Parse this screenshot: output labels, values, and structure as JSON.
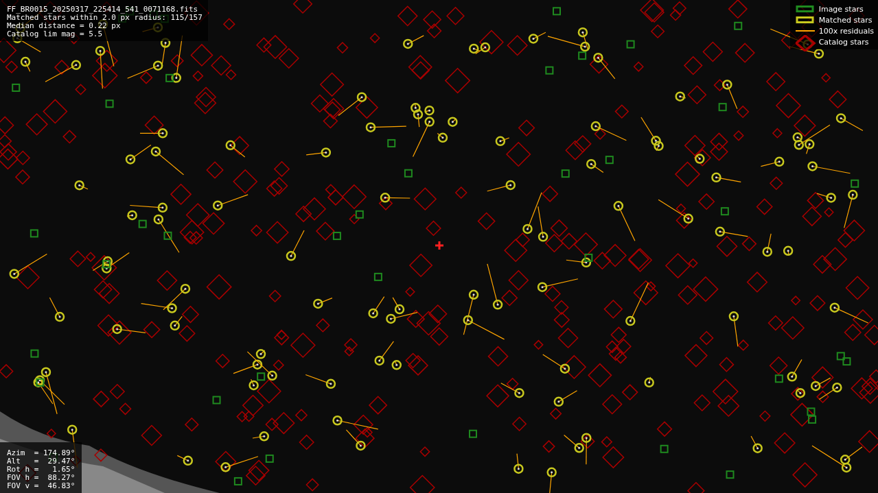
{
  "info_panel": {
    "lines": [
      "FF_BR0015_20250317_225414_541_0071168.fits",
      "Matched stars within 2.0 px radius: 115/157",
      "Median distance = 0.22 px",
      "Catalog lim mag = 5.5"
    ]
  },
  "legend": {
    "items": [
      {
        "kind": "image",
        "label": "Image stars",
        "color": "#1f8a1f"
      },
      {
        "kind": "matched",
        "label": "Matched stars",
        "color": "#c8c81e"
      },
      {
        "kind": "residual",
        "label": "100x residuals",
        "color": "#ffa500"
      },
      {
        "kind": "catalog",
        "label": "Catalog stars",
        "color": "#a80000"
      }
    ]
  },
  "pointing_panel": {
    "lines": [
      "Azim  = 174.89°",
      "Alt   =  29.47°",
      "Rot h =   1.65°",
      "FOV h =  88.27°",
      "FOV v =  46.83°"
    ]
  }
}
